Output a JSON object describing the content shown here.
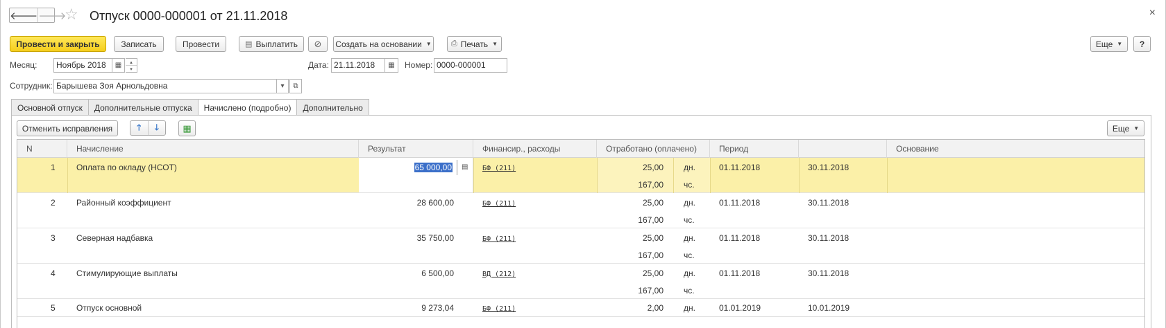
{
  "window": {
    "title": "Отпуск 0000-000001 от 21.11.2018",
    "close": "×",
    "back": "🡐",
    "forward": "🡒",
    "star": "☆"
  },
  "toolbar": {
    "post_close": "Провести и закрыть",
    "save": "Записать",
    "post": "Провести",
    "pay": "Выплатить",
    "create_based": "Создать на основании",
    "print": "Печать",
    "more": "Еще",
    "help": "?"
  },
  "form": {
    "month_label": "Месяц:",
    "month_value": "Ноябрь 2018",
    "date_label": "Дата:",
    "date_value": "21.11.2018",
    "number_label": "Номер:",
    "number_value": "0000-000001",
    "employee_label": "Сотрудник:",
    "employee_value": "Барышева Зоя Арнольдовна"
  },
  "tabs": [
    {
      "label": "Основной отпуск"
    },
    {
      "label": "Дополнительные отпуска"
    },
    {
      "label": "Начислено (подробно)"
    },
    {
      "label": "Дополнительно"
    }
  ],
  "panel": {
    "cancel_fix": "Отменить исправления",
    "more": "Еще"
  },
  "table": {
    "headers": {
      "n": "N",
      "accrual": "Начисление",
      "result": "Результат",
      "finance": "Финансир., расходы",
      "worked": "Отработано (оплачено)",
      "period": "Период",
      "period_end": "",
      "basis": "Основание"
    },
    "rows": [
      {
        "n": "1",
        "accrual": "Оплата по окладу (НСОТ)",
        "result": "65 000,00",
        "finance": "БФ (211)",
        "days": "25,00",
        "days_unit": "дн.",
        "hours": "167,00",
        "hours_unit": "чс.",
        "start": "01.11.2018",
        "end": "30.11.2018"
      },
      {
        "n": "2",
        "accrual": "Районный коэффициент",
        "result": "28 600,00",
        "finance": "БФ (211)",
        "days": "25,00",
        "days_unit": "дн.",
        "hours": "167,00",
        "hours_unit": "чс.",
        "start": "01.11.2018",
        "end": "30.11.2018"
      },
      {
        "n": "3",
        "accrual": "Северная надбавка",
        "result": "35 750,00",
        "finance": "БФ (211)",
        "days": "25,00",
        "days_unit": "дн.",
        "hours": "167,00",
        "hours_unit": "чс.",
        "start": "01.11.2018",
        "end": "30.11.2018"
      },
      {
        "n": "4",
        "accrual": "Стимулирующие выплаты",
        "result": "6 500,00",
        "finance": "ВД (212)",
        "days": "25,00",
        "days_unit": "дн.",
        "hours": "167,00",
        "hours_unit": "чс.",
        "start": "01.11.2018",
        "end": "30.11.2018"
      },
      {
        "n": "5",
        "accrual": "Отпуск основной",
        "result": "9 273,04",
        "finance": "БФ (211)",
        "days": "2,00",
        "days_unit": "дн.",
        "hours": "",
        "hours_unit": "",
        "start": "01.01.2019",
        "end": "10.01.2019"
      }
    ]
  },
  "colors": {
    "primary_button": "#f5ce1c",
    "selected_row": "#fbf0a8",
    "selection": "#3b6fc9"
  }
}
